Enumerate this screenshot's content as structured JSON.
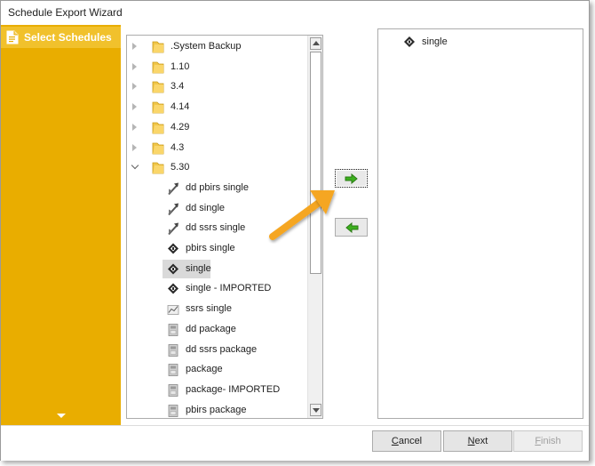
{
  "window": {
    "title": "Schedule Export Wizard"
  },
  "sidebar": {
    "items": [
      {
        "label": "Select Schedules",
        "icon": "document-icon"
      }
    ],
    "expand_icon": "chevron-down-icon"
  },
  "tree": {
    "folders": [
      {
        "label": ".System Backup",
        "expanded": false
      },
      {
        "label": "1.10",
        "expanded": false
      },
      {
        "label": "3.4",
        "expanded": false
      },
      {
        "label": "4.14",
        "expanded": false
      },
      {
        "label": "4.29",
        "expanded": false
      },
      {
        "label": "4.3",
        "expanded": false
      },
      {
        "label": "5.30",
        "expanded": true
      }
    ],
    "children": [
      {
        "label": "dd pbirs single",
        "icon": "data-driven-schedule-icon"
      },
      {
        "label": "dd single",
        "icon": "data-driven-schedule-icon"
      },
      {
        "label": "dd ssrs single",
        "icon": "data-driven-schedule-icon"
      },
      {
        "label": "pbirs single",
        "icon": "single-schedule-icon"
      },
      {
        "label": "single",
        "icon": "single-schedule-icon",
        "selected": true
      },
      {
        "label": "single - IMPORTED",
        "icon": "single-schedule-icon"
      },
      {
        "label": "ssrs single",
        "icon": "ssrs-schedule-icon"
      },
      {
        "label": "dd package",
        "icon": "package-icon"
      },
      {
        "label": "dd ssrs package",
        "icon": "package-icon"
      },
      {
        "label": "package",
        "icon": "package-icon"
      },
      {
        "label": "package- IMPORTED",
        "icon": "package-icon"
      },
      {
        "label": "pbirs package",
        "icon": "package-icon"
      }
    ]
  },
  "move": {
    "add_icon": "arrow-right-icon",
    "remove_icon": "arrow-left-icon",
    "add_color": "#3cb01e",
    "remove_color": "#3cb01e"
  },
  "selected_list": {
    "items": [
      {
        "label": "single",
        "icon": "single-schedule-icon"
      }
    ]
  },
  "footer": {
    "cancel": {
      "first": "C",
      "rest": "ancel"
    },
    "next": {
      "first": "N",
      "rest": "ext"
    },
    "finish": {
      "first": "F",
      "rest": "inish"
    }
  },
  "colors": {
    "sidebar": "#e9ad00",
    "sidebar_active": "#f1c12c",
    "callout_arrow": "#f5a623"
  }
}
